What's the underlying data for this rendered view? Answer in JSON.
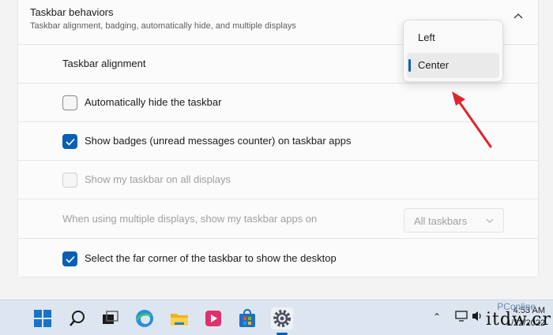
{
  "header": {
    "title": "Taskbar behaviors",
    "subtitle": "Taskbar alignment, badging, automatically hide, and multiple displays"
  },
  "rows": [
    {
      "label": "Taskbar alignment"
    },
    {
      "label": "Automatically hide the taskbar",
      "checked": false
    },
    {
      "label": "Show badges (unread messages counter) on taskbar apps",
      "checked": true
    },
    {
      "label": "Show my taskbar on all displays",
      "checked": false,
      "disabled": true
    },
    {
      "label": "When using multiple displays, show my taskbar apps on",
      "disabled": true,
      "select_value": "All taskbars"
    },
    {
      "label": "Select the far corner of the taskbar to show the desktop",
      "checked": true
    }
  ],
  "dropdown": {
    "options": [
      "Left",
      "Center"
    ],
    "selected": "Center"
  },
  "taskbar": {
    "apps": [
      "windows-start-icon",
      "search-icon",
      "task-view-icon",
      "edge-browser-icon",
      "file-explorer-icon",
      "media-player-icon",
      "microsoft-store-icon",
      "settings-gear-icon"
    ],
    "time": "4:53 AM",
    "date": "1/22/2022"
  },
  "watermark": {
    "text": "itdw.cr",
    "small": "PConline"
  },
  "colors": {
    "accent": "#0a5fb4",
    "arrow": "#e0242a"
  }
}
